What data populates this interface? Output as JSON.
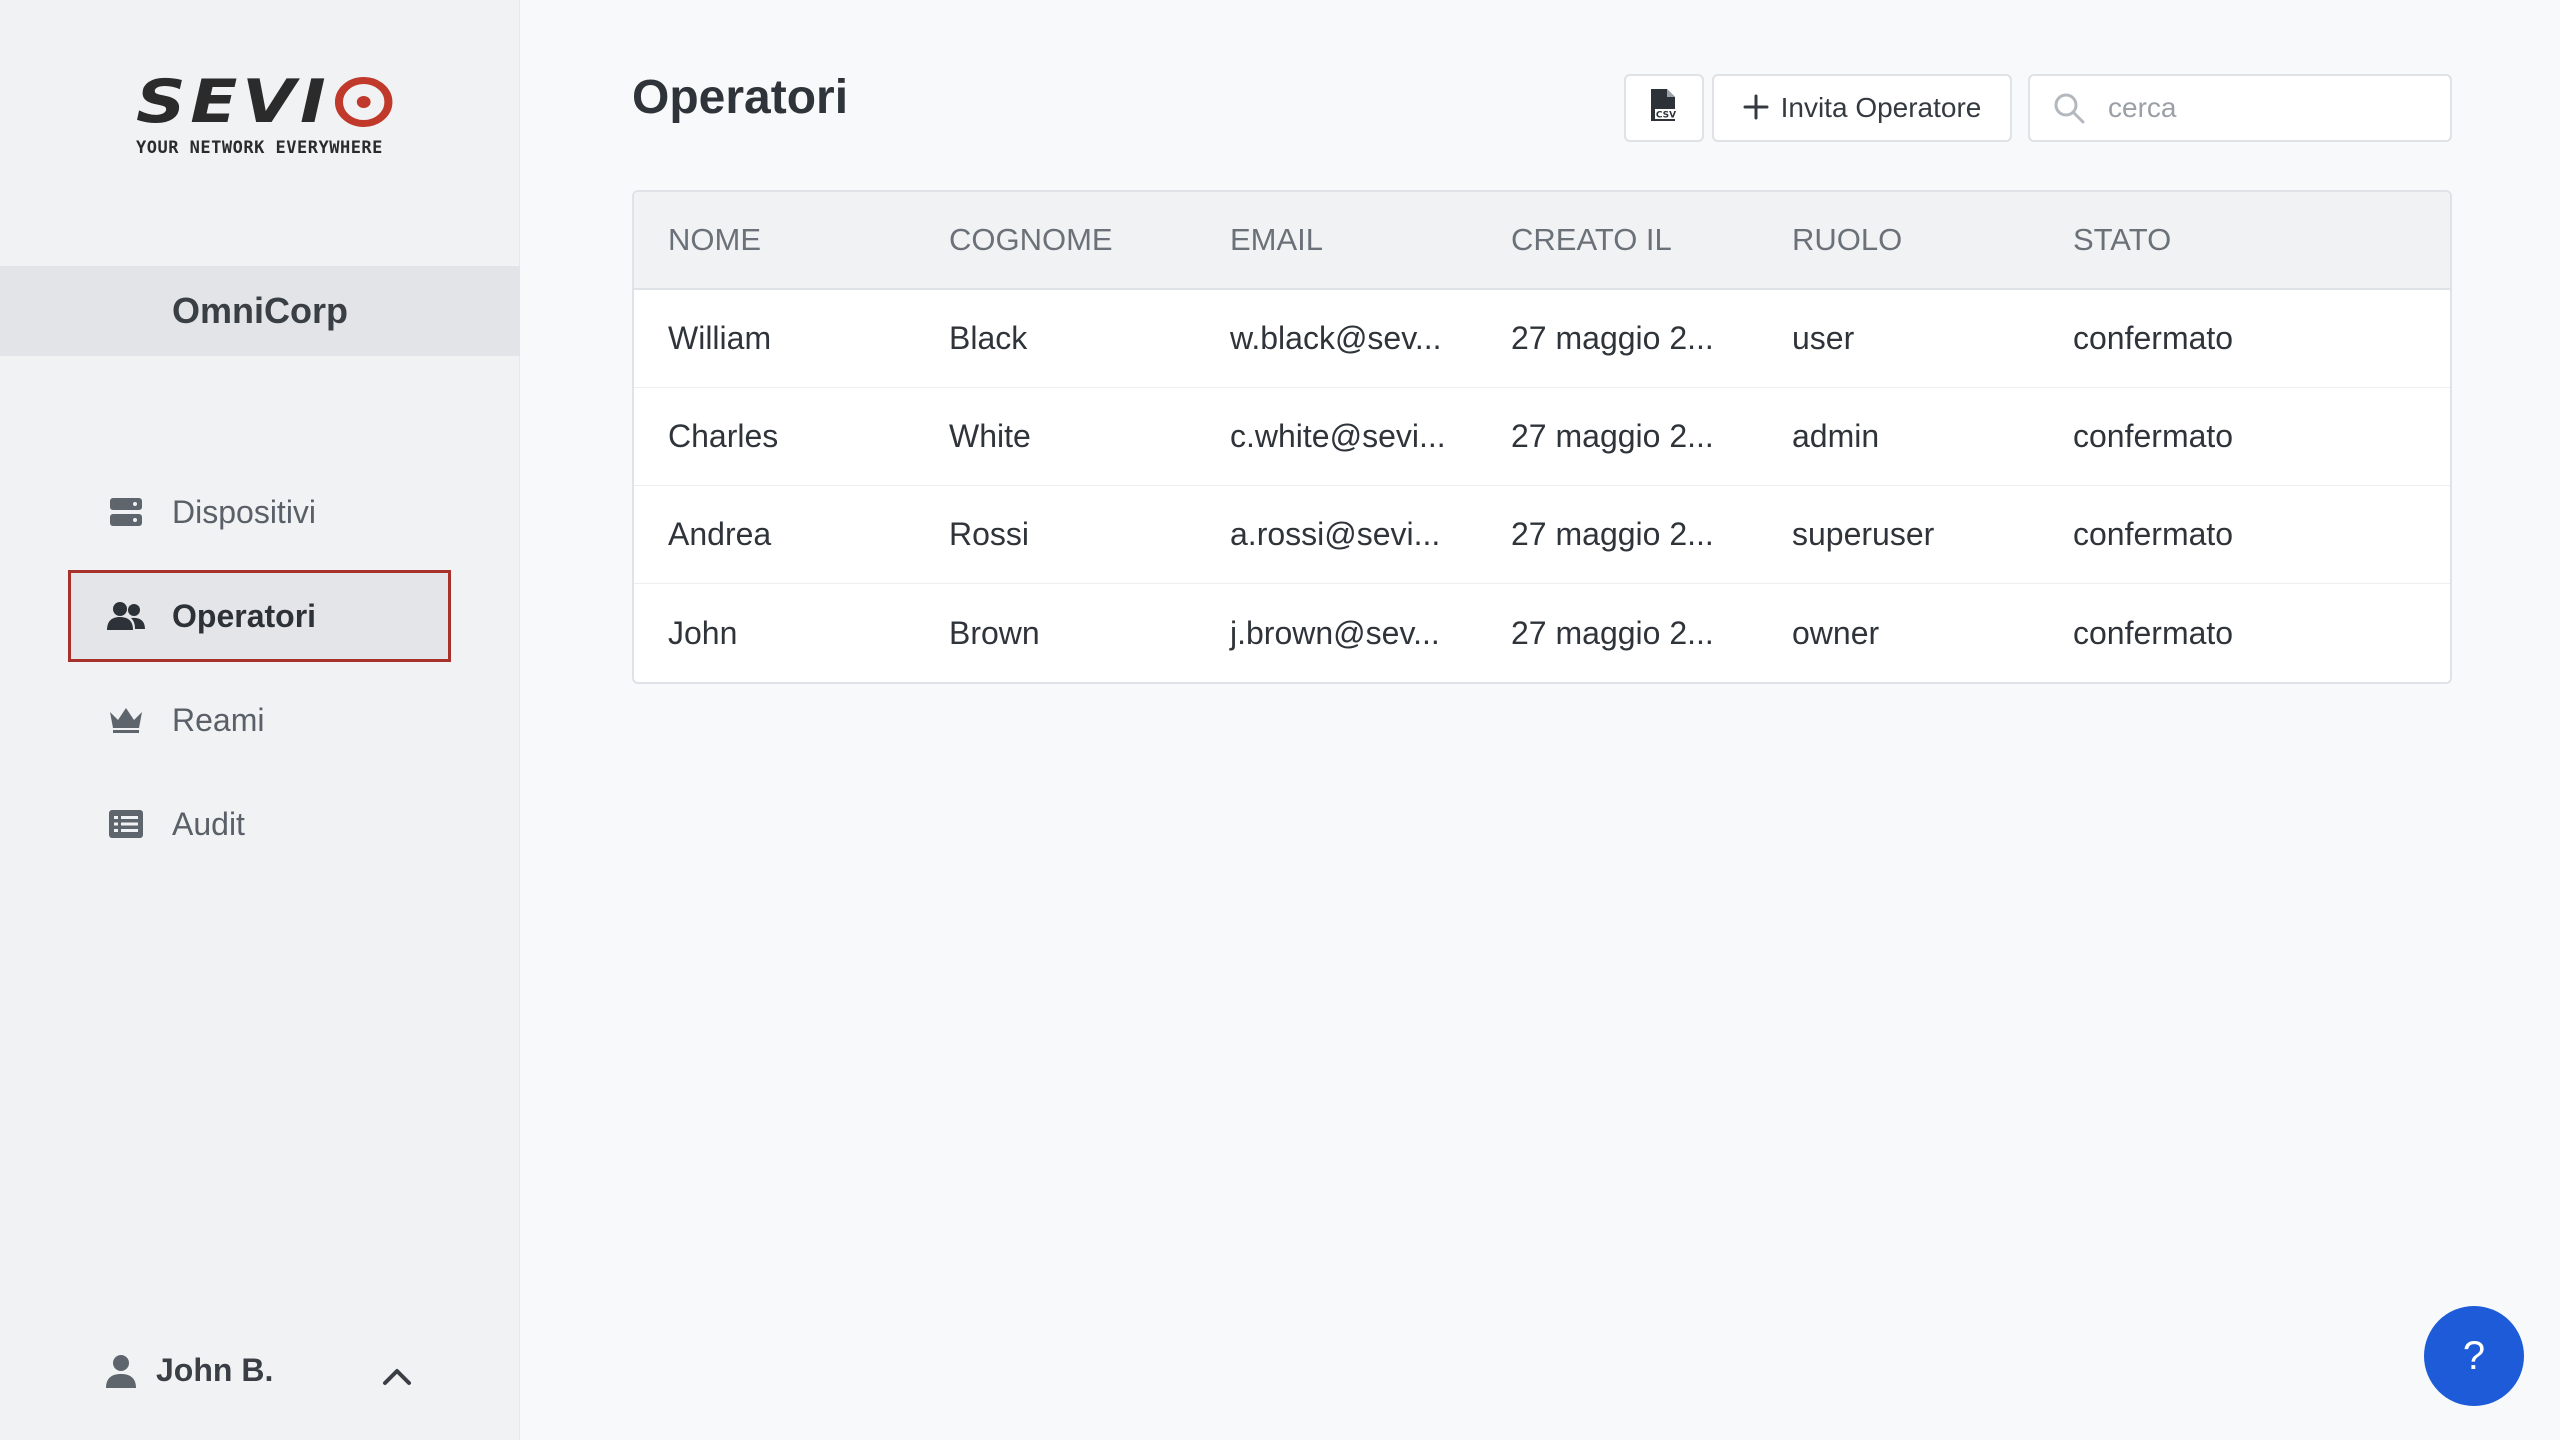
{
  "brand": {
    "logo_text": "SEVI",
    "tagline": "YOUR NETWORK EVERYWHERE",
    "accent": "#c0392b"
  },
  "sidebar": {
    "org_name": "OmniCorp",
    "items": [
      {
        "label": "Dispositivi",
        "icon": "server-icon"
      },
      {
        "label": "Operatori",
        "icon": "users-icon",
        "active": true
      },
      {
        "label": "Reami",
        "icon": "crown-icon"
      },
      {
        "label": "Audit",
        "icon": "list-icon"
      }
    ],
    "user_name": "John B."
  },
  "main": {
    "title": "Operatori",
    "invite_label": "Invita Operatore",
    "search_placeholder": "cerca",
    "columns": [
      "NOME",
      "COGNOME",
      "EMAIL",
      "CREATO IL",
      "RUOLO",
      "STATO"
    ],
    "rows": [
      [
        "William",
        "Black",
        "w.black@sev...",
        "27 maggio 2...",
        "user",
        "confermato"
      ],
      [
        "Charles",
        "White",
        "c.white@sevi...",
        "27 maggio 2...",
        "admin",
        "confermato"
      ],
      [
        "Andrea",
        "Rossi",
        "a.rossi@sevi...",
        "27 maggio 2...",
        "superuser",
        "confermato"
      ],
      [
        "John",
        "Brown",
        "j.brown@sev...",
        "27 maggio 2...",
        "owner",
        "confermato"
      ]
    ]
  },
  "help_label": "?"
}
